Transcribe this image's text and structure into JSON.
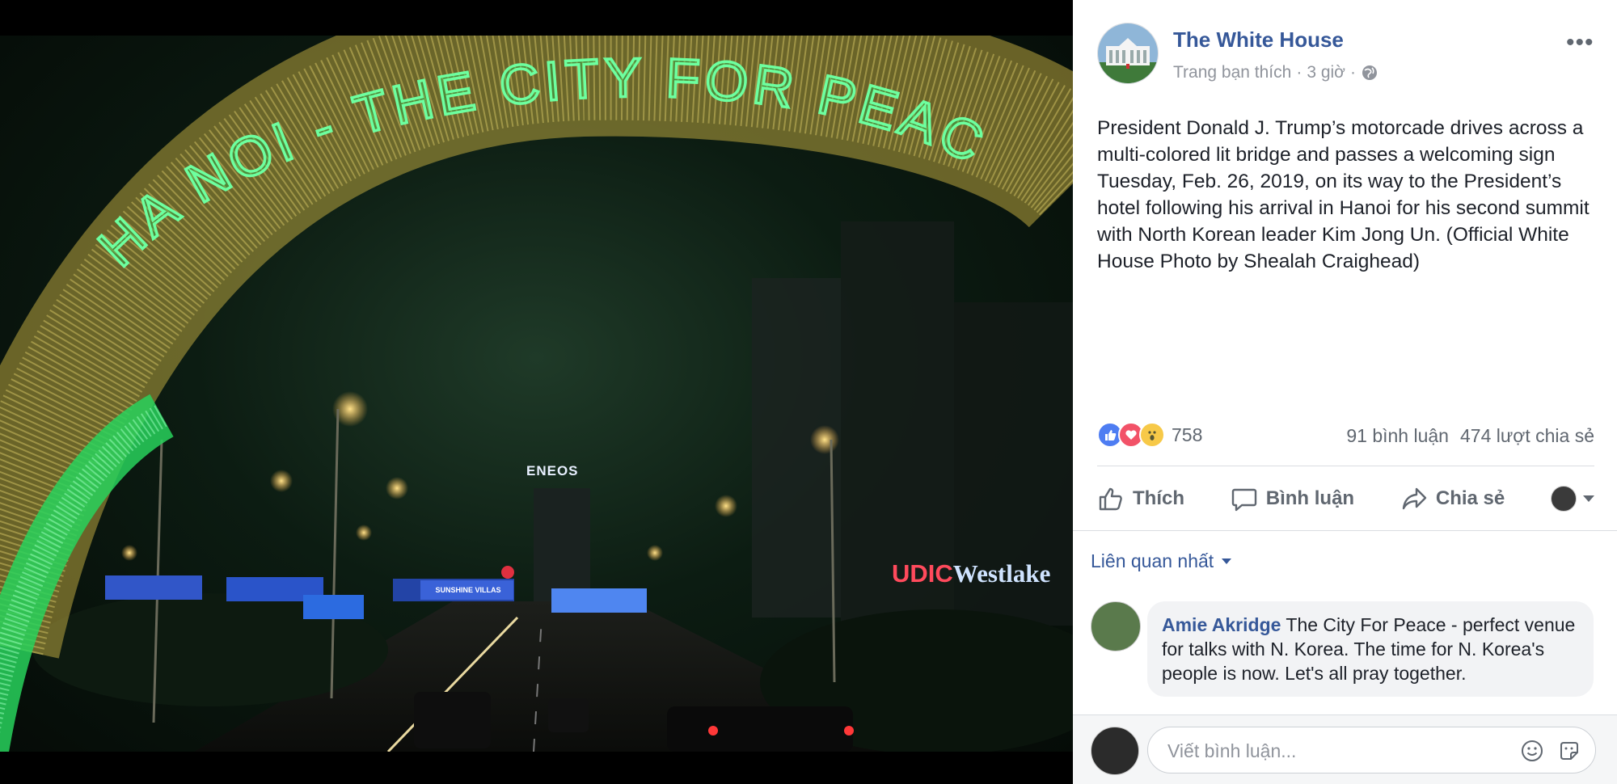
{
  "photo": {
    "arch_text": "HA NOI - THE CITY FOR PEACE",
    "sign_eneos": "ENEOS",
    "sign_udic_1": "UDIC",
    "sign_udic_2": "Westlake",
    "billboard_sunshine": "SUNSHINE VILLAS"
  },
  "post": {
    "page_name": "The White House",
    "meta_label": "Trang bạn thích",
    "meta_time": "3 giờ",
    "meta_separator": "·",
    "privacy_icon": "globe-icon",
    "more_icon": "more-dots-icon",
    "more_label": "•••",
    "text": "President Donald J. Trump’s motorcade drives across a multi-colored lit bridge and passes a welcoming sign Tuesday, Feb. 26, 2019, on its way to the President’s hotel following his arrival in Hanoi for his second summit with North Korean leader Kim Jong Un. (Official White House Photo by Shealah Craighead)"
  },
  "reactions": {
    "count": "758",
    "comments": "91 bình luận",
    "shares": "474 lượt chia sẻ",
    "types": [
      "like-icon",
      "love-icon",
      "wow-icon"
    ]
  },
  "actions": {
    "like": "Thích",
    "comment": "Bình luận",
    "share": "Chia sẻ"
  },
  "comments": {
    "sort_label": "Liên quan nhất",
    "items": [
      {
        "author": "Amie Akridge",
        "text": "The City For Peace - perfect venue for talks with N. Korea. The time for N. Korea's people is now. Let's all pray together."
      }
    ]
  },
  "composer": {
    "placeholder": "Viết bình luận..."
  },
  "colors": {
    "link": "#365899",
    "meta": "#90949c",
    "text": "#1d2129",
    "like_blue": "#4e7df2",
    "love_red": "#f25268",
    "wow_yellow": "#f7c948",
    "arch_green": "#6dff9f"
  }
}
